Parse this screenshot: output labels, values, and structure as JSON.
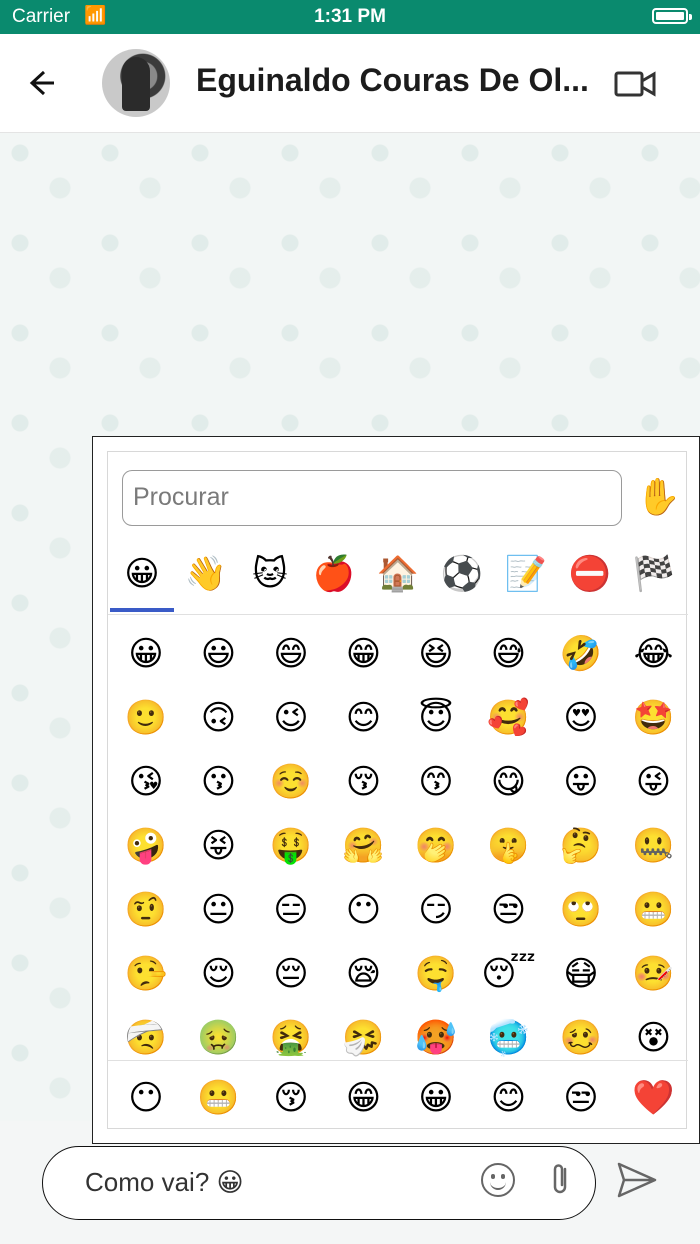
{
  "status": {
    "carrier": "Carrier",
    "time": "1:31 PM"
  },
  "header": {
    "title": "Eguinaldo Couras De Ol..."
  },
  "picker": {
    "search_placeholder": "Procurar",
    "skin_tone": "✋",
    "categories": [
      "😀",
      "👋",
      "🐱",
      "🍎",
      "🏠",
      "⚽",
      "📝",
      "⛔",
      "🏁"
    ],
    "emojis": [
      "😀",
      "😃",
      "😄",
      "😁",
      "😆",
      "😅",
      "🤣",
      "😂",
      "🙂",
      "🙃",
      "😉",
      "😊",
      "😇",
      "🥰",
      "😍",
      "🤩",
      "😘",
      "😗",
      "☺️",
      "😚",
      "😙",
      "😋",
      "😛",
      "😜",
      "🤪",
      "😝",
      "🤑",
      "🤗",
      "🤭",
      "🤫",
      "🤔",
      "🤐",
      "🤨",
      "😐",
      "😑",
      "😶",
      "😏",
      "😒",
      "🙄",
      "😬",
      "🤥",
      "😌",
      "😔",
      "😪",
      "🤤",
      "😴",
      "😷",
      "🤒",
      "🤕",
      "🤢",
      "🤮",
      "🤧",
      "🥵",
      "🥶",
      "🥴",
      "😵"
    ],
    "recent": [
      "😶",
      "😬",
      "😚",
      "😁",
      "😀",
      "😊",
      "😒",
      "❤️"
    ]
  },
  "composer": {
    "message": "Como vai? 😀"
  },
  "icons": {
    "back": "arrow-left-icon",
    "video": "video-camera-icon",
    "emoji": "smiley-icon",
    "attach": "paperclip-icon",
    "send": "send-icon"
  },
  "colors": {
    "status_bar": "#0a8a6e",
    "accent": "#3a5bc7"
  }
}
